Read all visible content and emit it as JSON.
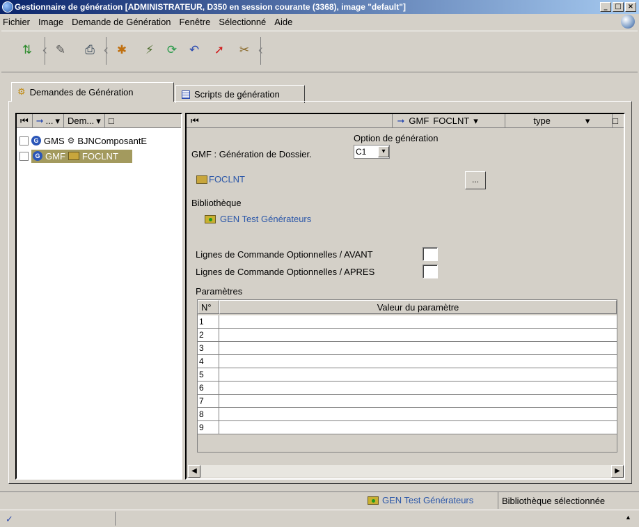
{
  "window": {
    "title": "Gestionnaire de génération [ADMINISTRATEUR, D350 en session courante (3368), image \"default\"]",
    "minimize": "_",
    "maximize": "□",
    "close": "×"
  },
  "menu": [
    "Fichier",
    "Image",
    "Demande de Génération",
    "Fenêtre",
    "Sélectionné",
    "Aide"
  ],
  "tabs": [
    {
      "label": "Demandes de Génération",
      "active": true
    },
    {
      "label": "Scripts de génération",
      "active": false
    }
  ],
  "left_pane": {
    "header_dropdown_1": "...",
    "header_dropdown_2": "Dem...",
    "items": [
      {
        "type": "GMS",
        "name": "BJNComposantE",
        "selected": false
      },
      {
        "type": "GMF",
        "name": "FOCLNT",
        "selected": true
      }
    ]
  },
  "right_pane": {
    "header_type": "GMF",
    "header_name": "FOCLNT",
    "header_col": "type",
    "option_label": "Option de génération",
    "gmf_label": "GMF : Génération de Dossier.",
    "option_value": "C1",
    "dossier_link": "FOCLNT",
    "browse_button": "...",
    "bibliotheque_label": "Bibliothèque",
    "bibliotheque_value": "GEN Test Générateurs",
    "avant_label": "Lignes de Commande Optionnelles / AVANT",
    "apres_label": "Lignes de Commande Optionnelles / APRES",
    "parametres_label": "Paramètres",
    "table": {
      "columns": [
        "N°",
        "Valeur du paramètre"
      ],
      "rows": [
        "1",
        "2",
        "3",
        "4",
        "5",
        "6",
        "7",
        "8",
        "9"
      ]
    }
  },
  "statusbar": {
    "library": "GEN Test Générateurs",
    "status": "Bibliothèque sélectionnée",
    "check": "✓",
    "arrow": "▲"
  },
  "icons": {
    "toolbar": [
      "refresh-icon",
      "pin-icon",
      "print-icon",
      "build-icon",
      "link-icon",
      "cycle-icon",
      "undo-icon",
      "send-icon",
      "stamp-icon"
    ]
  }
}
